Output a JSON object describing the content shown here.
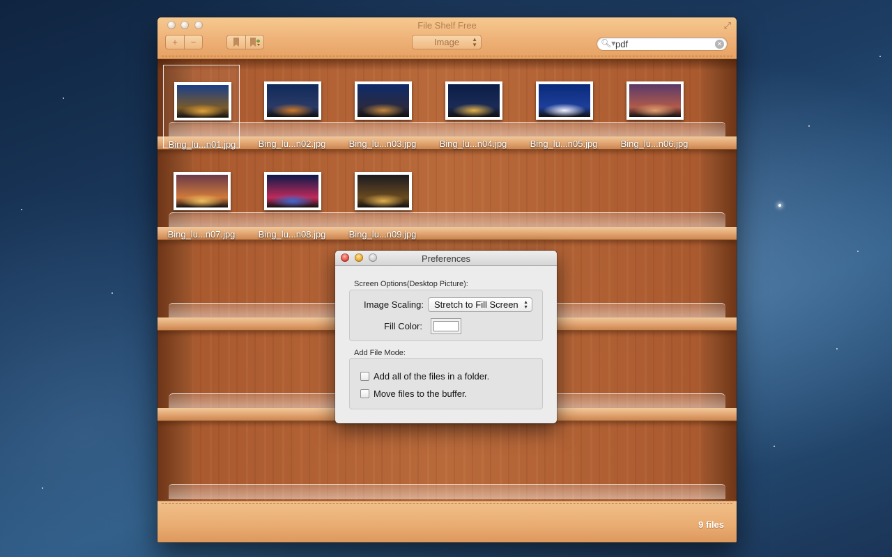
{
  "window": {
    "title": "File Shelf Free",
    "toolbar": {
      "add_label": "+",
      "remove_label": "−",
      "kind_popup": "Image",
      "search_value": "pdf"
    }
  },
  "shelf": {
    "items": [
      {
        "label": "Bing_lu...n01.jpg",
        "colors": [
          "#1a3f8a",
          "#7a5a2a",
          "#e0a23a"
        ]
      },
      {
        "label": "Bing_lu...n02.jpg",
        "colors": [
          "#102a5a",
          "#2b3a66",
          "#d07a2a"
        ]
      },
      {
        "label": "Bing_lu...n03.jpg",
        "colors": [
          "#0e2b6a",
          "#2a2a40",
          "#c58a3c"
        ]
      },
      {
        "label": "Bing_lu...n04.jpg",
        "colors": [
          "#0a1e48",
          "#1b2b55",
          "#e6b44a"
        ]
      },
      {
        "label": "Bing_lu...n05.jpg",
        "colors": [
          "#0a2a7a",
          "#1d3f9a",
          "#f2f2ff"
        ]
      },
      {
        "label": "Bing_lu...n06.jpg",
        "colors": [
          "#5a3a6a",
          "#b05a4a",
          "#e0a070"
        ]
      },
      {
        "label": "Bing_lu...n07.jpg",
        "colors": [
          "#6a3a4a",
          "#d07a3a",
          "#f0c060"
        ]
      },
      {
        "label": "Bing_lu...n08.jpg",
        "colors": [
          "#0a1a4a",
          "#c02a5a",
          "#3a6ad0"
        ]
      },
      {
        "label": "Bing_lu...n09.jpg",
        "colors": [
          "#1a1a20",
          "#6a4a20",
          "#e0b050"
        ]
      }
    ],
    "status": "9 files"
  },
  "preferences": {
    "title": "Preferences",
    "screen_options_label": "Screen Options(Desktop Picture):",
    "image_scaling_label": "Image Scaling:",
    "image_scaling_value": "Stretch to Fill Screen",
    "fill_color_label": "Fill Color:",
    "fill_color": "#ffffff",
    "add_file_mode_label": "Add File Mode:",
    "option_add_folder": "Add all of the files in a folder.",
    "option_move_buffer": "Move files to the buffer."
  }
}
